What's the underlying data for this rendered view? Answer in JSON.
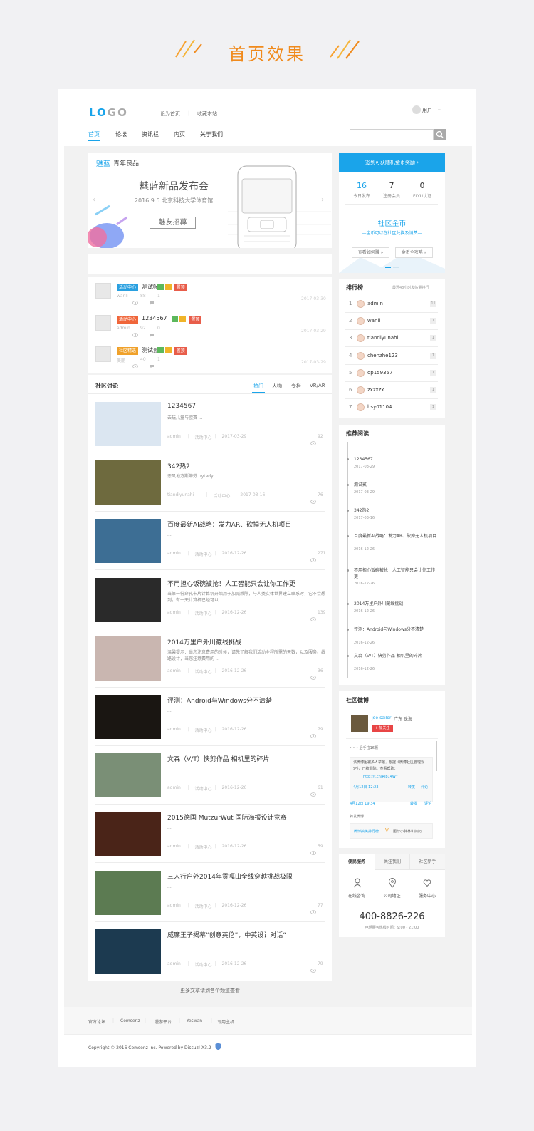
{
  "page_title": "首页效果",
  "header": {
    "logo": "LOGO",
    "links": [
      "设为首页",
      "收藏本站"
    ],
    "user": "用户",
    "nav": [
      "首页",
      "论坛",
      "资讯栏",
      "内页",
      "关于我们"
    ],
    "search_placeholder": ""
  },
  "banner": {
    "brand": "魅蓝",
    "slogan": "青年良品",
    "title": "魅蓝新品发布会",
    "subtitle": "2016.9.5  北京科技大学体育馆",
    "button": "魅友招募"
  },
  "featured": [
    {
      "tag": "活动中心",
      "tag_color": "#2aa0e0",
      "title": "测试帖",
      "badge": "置顶",
      "author": "wanli",
      "views": "88",
      "replies": "1",
      "date": "2017-03-30"
    },
    {
      "tag": "活动中心",
      "tag_color": "#f0663a",
      "title": "1234567",
      "badge": "置顶",
      "author": "admin",
      "views": "92",
      "replies": "0",
      "date": "2017-03-29"
    },
    {
      "tag": "社区精选",
      "tag_color": "#f0a12a",
      "title": "测试贰",
      "badge": "置顶",
      "author": "美丽",
      "views": "40",
      "replies": "1",
      "date": "2017-03-29"
    }
  ],
  "discuss": {
    "title": "社区讨论",
    "tabs": [
      "热门",
      "人物",
      "专栏",
      "VR/AR"
    ],
    "articles": [
      {
        "title": "1234567",
        "desc": "去玩儿童与欧赛 ...",
        "author": "admin",
        "cat": "活动中心",
        "date": "2017-03-29",
        "views": "92",
        "thumb": "#dbe6f1"
      },
      {
        "title": "342热2",
        "desc": "恶风地方斯蒂芬 uytedy ...",
        "author": "tiandiyunahi",
        "cat": "活动中心",
        "date": "2017-03-16",
        "views": "76",
        "thumb": "#6e6a3e"
      },
      {
        "title": "百度最新AI战略：发力AR、砍掉无人机项目",
        "desc": "...",
        "author": "admin",
        "cat": "活动中心",
        "date": "2016-12-26",
        "views": "271",
        "thumb": "#3d6e94"
      },
      {
        "title": "不用担心饭碗被抢！人工智能只会让你工作更",
        "desc": "当第一份穿孔卡片计算机开始用于加减乘除，与人类实体世界建立联系时，它不会想到，有一天计算机已经可以 ...",
        "author": "admin",
        "cat": "活动中心",
        "date": "2016-12-26",
        "views": "139",
        "thumb": "#2a2a2a"
      },
      {
        "title": "2014万里户外川藏线挑战",
        "desc": "温馨提示：当您注意费用的时候，请先了解我们活动全程所需的天数，以及服务、线路设计，当您注意费用的 ...",
        "author": "admin",
        "cat": "活动中心",
        "date": "2016-12-26",
        "views": "36",
        "thumb": "#c9b6b0"
      },
      {
        "title": "评测：Android与Windows分不清楚",
        "desc": "...",
        "author": "admin",
        "cat": "活动中心",
        "date": "2016-12-26",
        "views": "79",
        "thumb": "#1a1612"
      },
      {
        "title": "文森（V/T）快剪作品 相机里的碎片",
        "desc": "...",
        "author": "admin",
        "cat": "活动中心",
        "date": "2016-12-26",
        "views": "61",
        "thumb": "#7a8f76"
      },
      {
        "title": "2015德国 MutzurWut 国际海报设计竞赛",
        "desc": "...",
        "author": "admin",
        "cat": "活动中心",
        "date": "2016-12-26",
        "views": "59",
        "thumb": "#4a2418"
      },
      {
        "title": "三人行户外2014年贡嘎山全线穿越挑战极限",
        "desc": "...",
        "author": "admin",
        "cat": "活动中心",
        "date": "2016-12-26",
        "views": "77",
        "thumb": "#5c7b52"
      },
      {
        "title": "威廉王子揭幕“创意英伦”，中英设计对话“",
        "desc": "...",
        "author": "admin",
        "cat": "活动中心",
        "date": "2016-12-26",
        "views": "79",
        "thumb": "#1c3a50"
      }
    ],
    "more": "更多文章请到各个频道查看"
  },
  "sidebar": {
    "signin": "签到可获随机金币奖励 ›",
    "stats": [
      {
        "num": "16",
        "label": "今日发布"
      },
      {
        "num": "7",
        "label": "注册会员"
      },
      {
        "num": "0",
        "label": "FLYU认证"
      }
    ],
    "coin_title": "社区金币",
    "coin_sub": "—金币可以在社区兑换及消费—",
    "coin_btns": [
      "查看如何赚 »",
      "金币全攻略 »"
    ],
    "rank_title": "排行榜",
    "rank_note": "最近48小时发帖量排行",
    "rank": [
      {
        "n": "1",
        "name": "admin",
        "c": "11"
      },
      {
        "n": "2",
        "name": "wanli",
        "c": "1"
      },
      {
        "n": "3",
        "name": "tiandiyunahi",
        "c": "1"
      },
      {
        "n": "4",
        "name": "chenzhe123",
        "c": "1"
      },
      {
        "n": "5",
        "name": "op159357",
        "c": "1"
      },
      {
        "n": "6",
        "name": "zxzxzx",
        "c": "1"
      },
      {
        "n": "7",
        "name": "hsy01104",
        "c": "1"
      }
    ],
    "read_title": "推荐阅读",
    "reads": [
      {
        "t": "1234567",
        "d": "2017-03-29"
      },
      {
        "t": "测试贰",
        "d": "2017-03-29"
      },
      {
        "t": "342热2",
        "d": "2017-03-16"
      },
      {
        "t": "百度最新AI战略：发力AR、砍掉无人机项目",
        "d": "2016-12-26"
      },
      {
        "t": "不用担心饭碗被抢！人工智能只会让你工作更",
        "d": "2016-12-26"
      },
      {
        "t": "2014万里户外川藏线挑战",
        "d": "2016-12-26"
      },
      {
        "t": "评测：Android与Windows分不清楚",
        "d": "2016-12-26"
      },
      {
        "t": "文森（V/T）快剪作品 相机里的碎片",
        "d": "2016-12-26"
      }
    ],
    "weibo_title": "社区微博",
    "weibo_user": "joe-sailor",
    "weibo_loc": "广东 珠海",
    "weibo_follow": "+ 加关注",
    "weibo_line1": "• • • 后手拉16颗",
    "weibo_text": "该微博因被多人举报，根据《微博社区管理规定》，已被删除。查看帮助：",
    "weibo_link": "http://t.cn/Rlb14WY",
    "weibo_date1": "4月12日 12:23",
    "weibo_date2": "4月12日 19:34",
    "weibo_actions": [
      "转发",
      "评论"
    ],
    "weibo_repost": "转发微博",
    "weibo_app": "微博搞笑排行榜",
    "weibo_app_text": "因分小胖林和奶奶",
    "service_tabs": [
      "便民服务",
      "关注我们",
      "社区新手"
    ],
    "services": [
      "在线咨询",
      "公司地址",
      "服务中心"
    ],
    "phone": "400-8826-226",
    "phone_hours": "电话服务热线时间：9:00 - 21:00"
  },
  "footer": {
    "links": [
      "官方论坛",
      "Comsenz",
      "漫游平台",
      "Yeswan",
      "专用主机"
    ],
    "copyright": "Copyright © 2016 Comsenz Inc. Powered by Discuz! X3.2"
  },
  "colors": {
    "accent": "#1aa4ea",
    "orange": "#f08a1c"
  }
}
